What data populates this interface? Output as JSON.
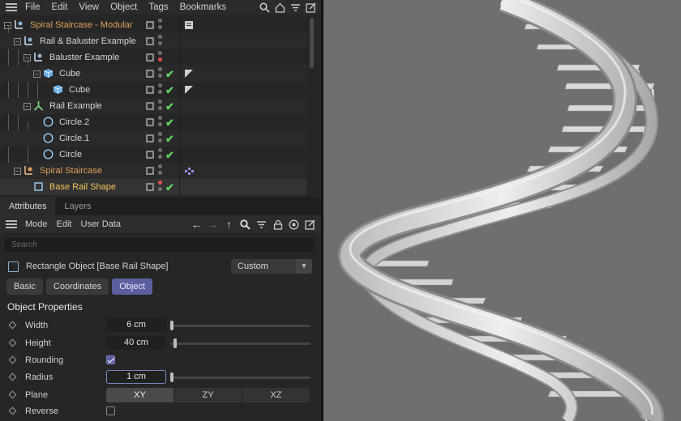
{
  "menubar": {
    "items": [
      "File",
      "Edit",
      "View",
      "Object",
      "Tags",
      "Bookmarks"
    ]
  },
  "tree": {
    "rows": [
      {
        "label": "Spiral Staircase - Modular",
        "color": "#e0a05a",
        "icon": "null-object-icon"
      },
      {
        "label": "Rail & Baluster Example",
        "icon": "null-object-icon"
      },
      {
        "label": "Baluster Example",
        "icon": "null-object-icon"
      },
      {
        "label": "Cube",
        "icon": "cube-icon"
      },
      {
        "label": "Cube",
        "icon": "cube-icon"
      },
      {
        "label": "Rail Example",
        "icon": "sweep-icon"
      },
      {
        "label": "Circle.2",
        "icon": "circle-spline-icon"
      },
      {
        "label": "Circle.1",
        "icon": "circle-spline-icon"
      },
      {
        "label": "Circle",
        "icon": "circle-spline-icon"
      },
      {
        "label": "Spiral Staircase",
        "color": "#e0a05a",
        "icon": "null-object-icon"
      },
      {
        "label": "Base Rail Shape",
        "color": "#f2c55a",
        "icon": "rectangle-spline-icon"
      }
    ]
  },
  "tabs": {
    "attributes": "Attributes",
    "layers": "Layers"
  },
  "attr_menu": {
    "mode": "Mode",
    "edit": "Edit",
    "user_data": "User Data"
  },
  "search": {
    "placeholder": "Search"
  },
  "object": {
    "title": "Rectangle Object [Base Rail Shape]",
    "preset": "Custom"
  },
  "subtabs": {
    "basic": "Basic",
    "coordinates": "Coordinates",
    "object": "Object"
  },
  "section": "Object Properties",
  "props": {
    "width": {
      "label": "Width",
      "value": "6 cm"
    },
    "height": {
      "label": "Height",
      "value": "40 cm"
    },
    "rounding": {
      "label": "Rounding",
      "checked": true
    },
    "radius": {
      "label": "Radius",
      "value": "1 cm"
    },
    "plane": {
      "label": "Plane",
      "options": [
        "XY",
        "ZY",
        "XZ"
      ],
      "selected": "XY"
    },
    "reverse": {
      "label": "Reverse",
      "checked": false
    }
  },
  "colors": {
    "accent": "#5b5fa0",
    "orange": "#e0a05a",
    "yellow": "#f2c55a",
    "check": "#5fd35f",
    "viewport": "#6f6f6f"
  }
}
